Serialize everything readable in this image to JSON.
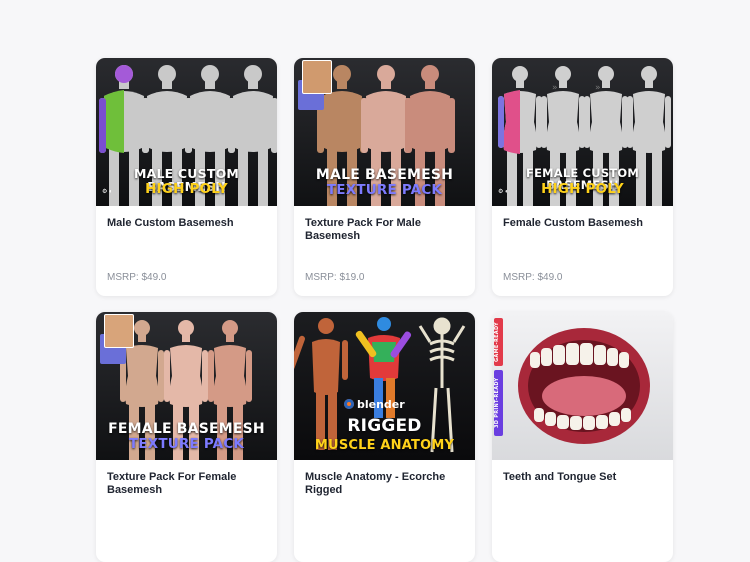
{
  "products": [
    {
      "title": "Male Custom Basemesh",
      "price": "MSRP: $49.0",
      "thumb_line1": "MALE CUSTOM BASEMESH",
      "thumb_line2": "HIGH POLY",
      "accent": "#ffd21a",
      "icon": "male-figures-image"
    },
    {
      "title": "Texture Pack For Male Basemesh",
      "price": "MSRP: $19.0",
      "thumb_line1": "MALE BASEMESH",
      "thumb_line2": "TEXTURE PACK",
      "accent": "#7d7bff",
      "icon": "male-textured-figures-image"
    },
    {
      "title": "Female Custom Basemesh",
      "price": "MSRP: $49.0",
      "thumb_line1": "FEMALE CUSTOM BASEMESH",
      "thumb_line2": "HIGH POLY",
      "accent": "#ffd21a",
      "icon": "female-figures-image"
    },
    {
      "title": "Texture Pack For Female Basemesh",
      "price": "",
      "thumb_line1": "FEMALE BASEMESH",
      "thumb_line2": "TEXTURE PACK",
      "accent": "#7d7bff",
      "icon": "female-textured-figures-image"
    },
    {
      "title": "Muscle Anatomy - Ecorche Rigged",
      "price": "",
      "thumb_line1": "RIGGED",
      "thumb_line2": "MUSCLE ANATOMY",
      "thumb_logo": "blender",
      "accent": "#ffd21a",
      "icon": "muscle-anatomy-image"
    },
    {
      "title": "Teeth and Tongue Set",
      "price": "",
      "badge_game": "GAME-READY",
      "badge_print": "3D PRINT-READY",
      "icon": "teeth-tongue-image"
    }
  ]
}
